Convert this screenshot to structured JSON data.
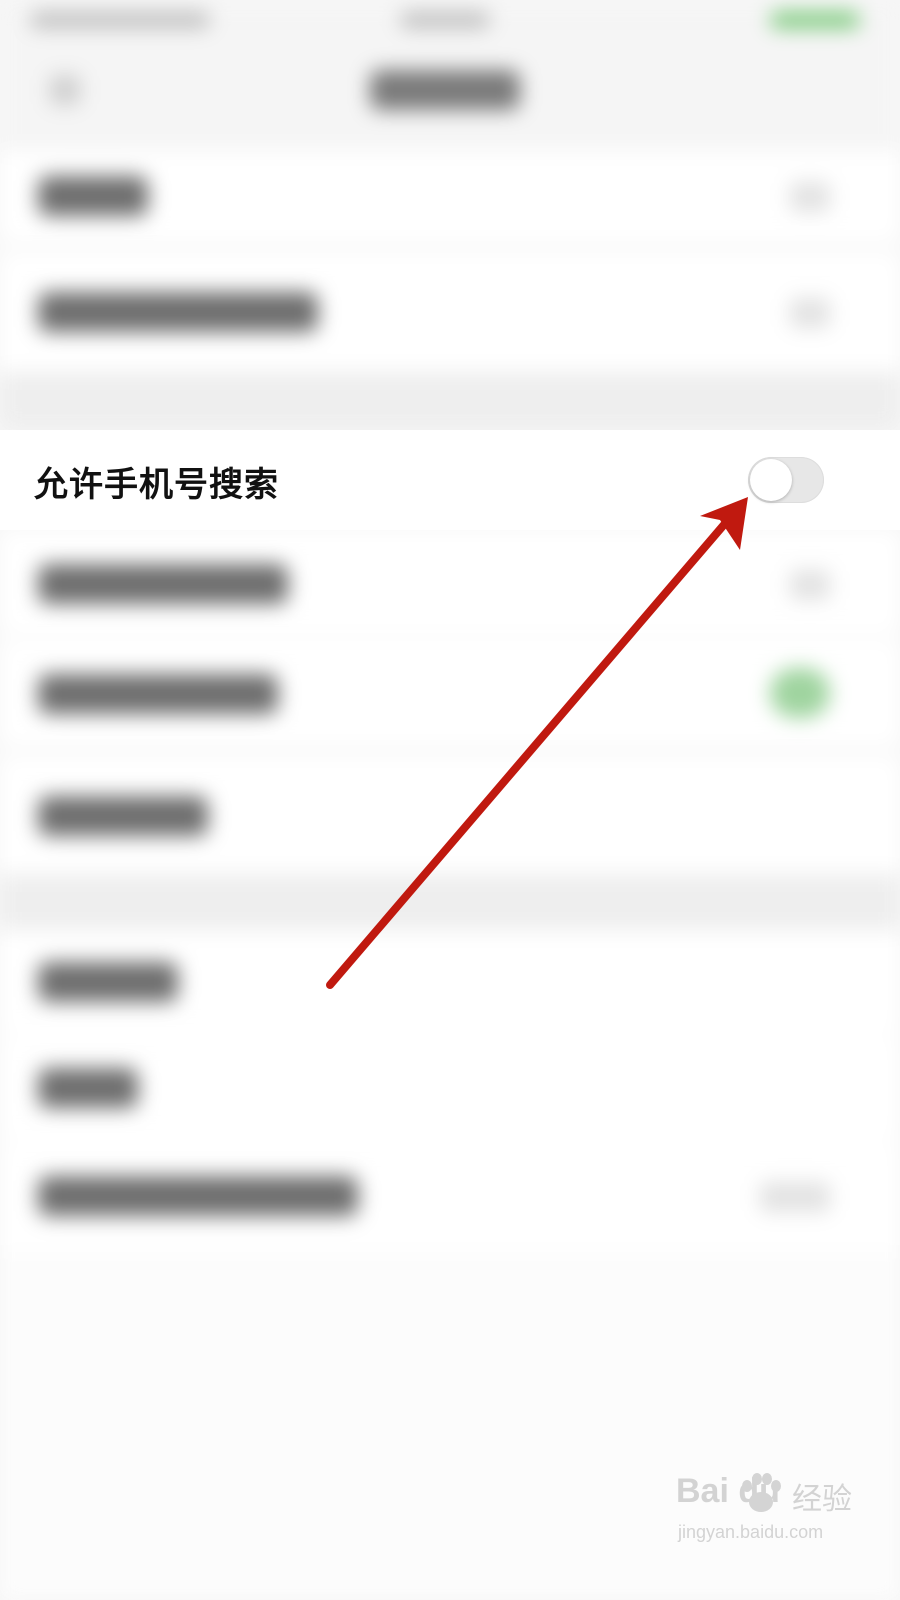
{
  "setting": {
    "label": "允许手机号搜索",
    "toggle_on": false
  },
  "annotation": {
    "arrow_color": "#c0190f"
  },
  "watermark": {
    "logo": "Bai du",
    "brand": "经验",
    "url": "jingyan.baidu.com"
  },
  "colors": {
    "toggle_off": "#e7e7e7",
    "accent_green": "#78c878"
  }
}
